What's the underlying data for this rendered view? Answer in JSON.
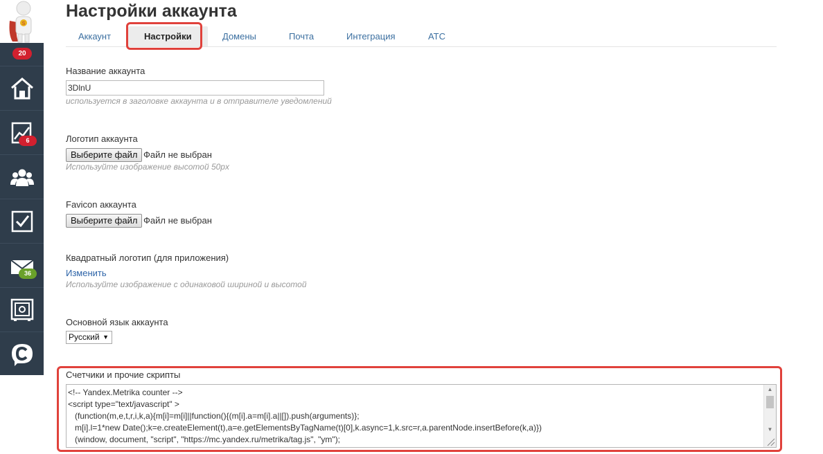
{
  "sidebar": {
    "top_badge": "20",
    "items": [
      {
        "icon": "home-icon"
      },
      {
        "icon": "chart-icon",
        "badge": "6",
        "badge_color": "#d2202f"
      },
      {
        "icon": "users-icon"
      },
      {
        "icon": "checkbox-icon"
      },
      {
        "icon": "mail-icon",
        "badge": "36",
        "badge_color": "#6aa12a"
      },
      {
        "icon": "safe-icon"
      },
      {
        "icon": "chat-c-icon"
      }
    ]
  },
  "page": {
    "title": "Настройки аккаунта"
  },
  "tabs": [
    {
      "label": "Аккаунт",
      "active": false
    },
    {
      "label": "Настройки",
      "active": true
    },
    {
      "label": "Домены",
      "active": false
    },
    {
      "label": "Почта",
      "active": false
    },
    {
      "label": "Интеграция",
      "active": false
    },
    {
      "label": "АТС",
      "active": false
    }
  ],
  "form": {
    "account_name": {
      "label": "Название аккаунта",
      "value": "3DlnU",
      "hint": "используется в заголовке аккаунта и в отправителе уведомлений"
    },
    "logo": {
      "label": "Логотип аккаунта",
      "button": "Выберите файл",
      "status": "Файл не выбран",
      "hint": "Используйте изображение высотой 50px"
    },
    "favicon": {
      "label": "Favicon аккаунта",
      "button": "Выберите файл",
      "status": "Файл не выбран"
    },
    "square_logo": {
      "label": "Квадратный логотип (для приложения)",
      "link": "Изменить",
      "hint": "Используйте изображение с одинаковой шириной и высотой"
    },
    "language": {
      "label": "Основной язык аккаунта",
      "selected": "Русский"
    },
    "scripts": {
      "label": "Счетчики и прочие скрипты",
      "lines": [
        "<!-- Yandex.Metrika counter -->",
        "<script type=\"text/javascript\" >",
        "   (function(m,e,t,r,i,k,a){m[i]=m[i]||function(){(m[i].a=m[i].a||[]).push(arguments)};",
        "   m[i].l=1*new Date();k=e.createElement(t),a=e.getElementsByTagName(t)[0],k.async=1,k.src=r,a.parentNode.insertBefore(k,a)})",
        "   (window, document, \"script\", \"https://mc.yandex.ru/metrika/tag.js\", \"ym\");"
      ]
    }
  },
  "colors": {
    "sidebar_bg": "#2f3d4b",
    "highlight": "#e0413b",
    "link": "#2d64a8",
    "tab_link": "#3b6fa0"
  }
}
